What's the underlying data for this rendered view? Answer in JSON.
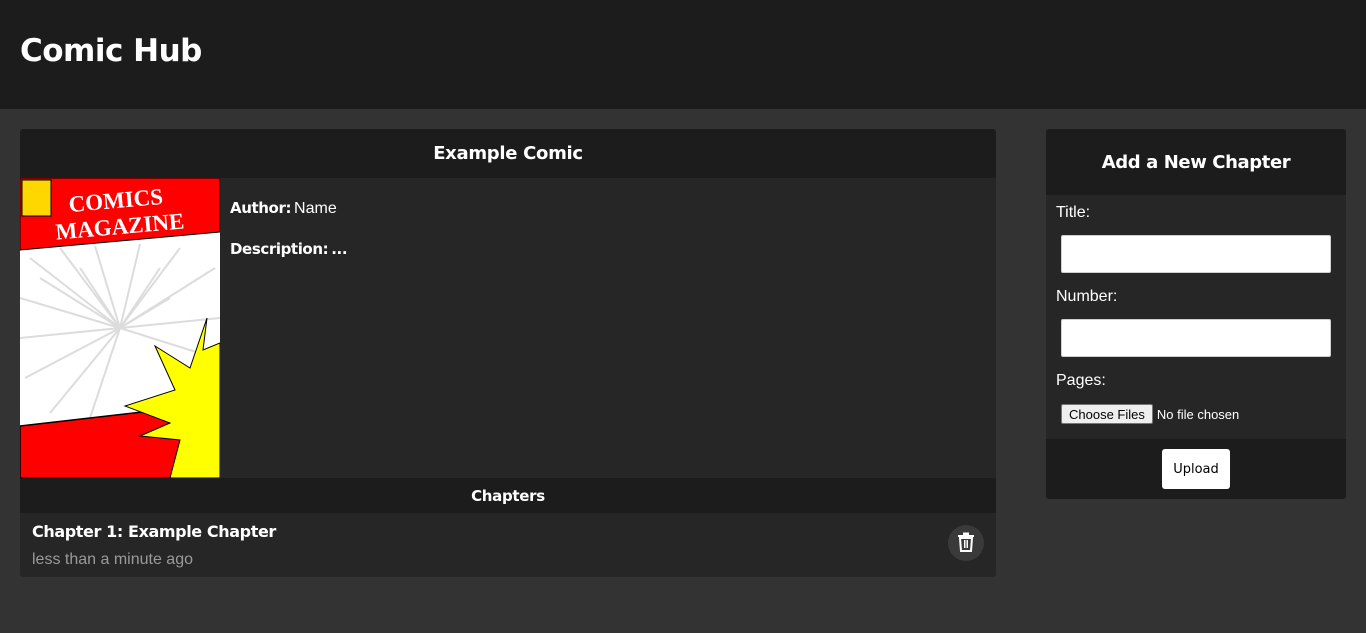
{
  "app": {
    "title": "Comic Hub"
  },
  "comic": {
    "title": "Example Comic",
    "cover": {
      "line1": "COMICS",
      "line2": "MAGAZINE"
    },
    "author_label": "Author:",
    "author_value": "Name",
    "description_label": "Description:",
    "description_value": "..."
  },
  "chapters": {
    "heading": "Chapters",
    "items": [
      {
        "title": "Chapter 1: Example Chapter",
        "time": "less than a minute ago",
        "delete_icon": "trash-icon"
      }
    ]
  },
  "add_chapter": {
    "heading": "Add a New Chapter",
    "title_label": "Title:",
    "title_value": "",
    "number_label": "Number:",
    "number_value": "",
    "pages_label": "Pages:",
    "file_button": "Choose Files",
    "file_status": "No file chosen",
    "upload_button": "Upload"
  },
  "colors": {
    "header_bg": "#1c1c1c",
    "page_bg": "#333333",
    "card_bg": "#262626",
    "cover_red": "#ff0000",
    "cover_yellow": "#ffff00"
  }
}
